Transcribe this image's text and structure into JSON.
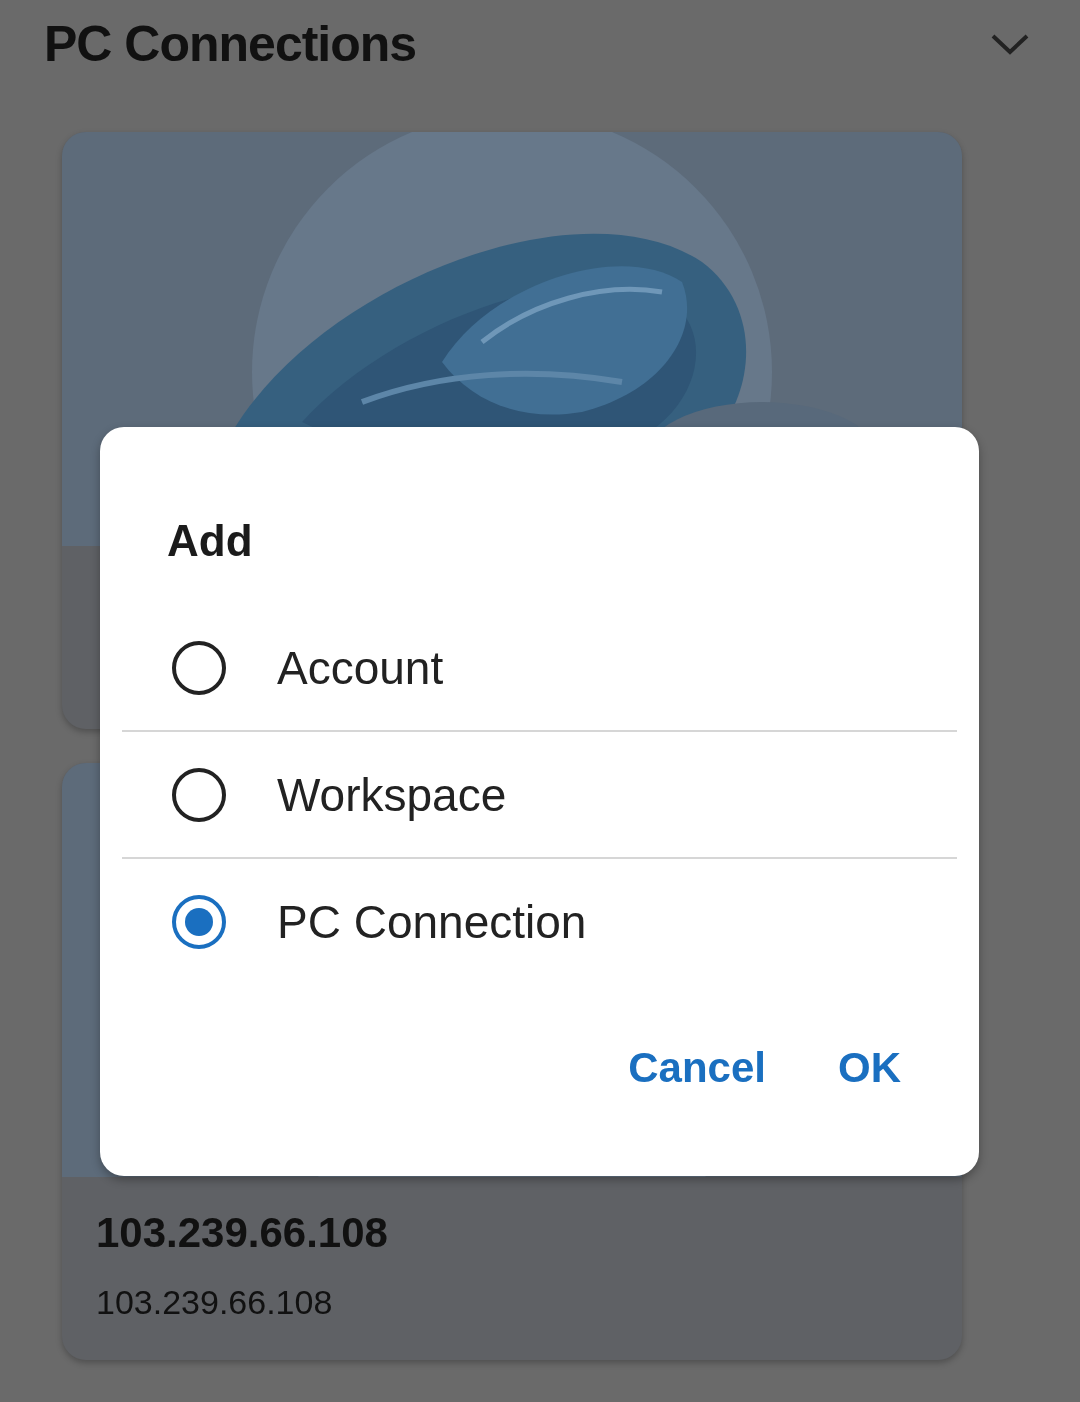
{
  "header": {
    "title": "PC Connections"
  },
  "cards": [
    {
      "kind": "picture"
    },
    {
      "kind": "picture",
      "title": "103.239.66.108",
      "subtitle": "103.239.66.108"
    }
  ],
  "dialog": {
    "title": "Add",
    "options": [
      {
        "label": "Account",
        "selected": false
      },
      {
        "label": "Workspace",
        "selected": false
      },
      {
        "label": "PC Connection",
        "selected": true
      }
    ],
    "buttons": [
      "Cancel",
      "OK"
    ]
  }
}
